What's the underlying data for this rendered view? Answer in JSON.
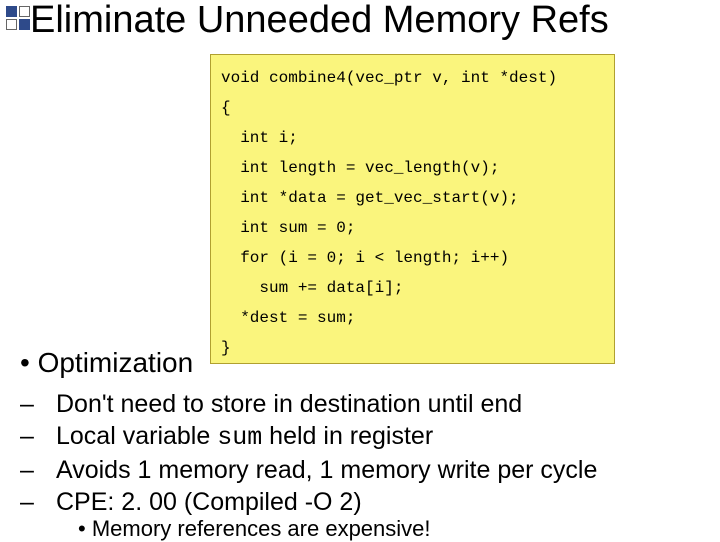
{
  "title": "Eliminate Unneeded Memory Refs",
  "code": {
    "l0": "void combine4(vec_ptr v, int *dest)",
    "l1": "{",
    "l2": "  int i;",
    "l3": "  int length = vec_length(v);",
    "l4": "  int *data = get_vec_start(v);",
    "l5": "  int sum = 0;",
    "l6": "  for (i = 0; i < length; i++)",
    "l7": "    sum += data[i];",
    "l8": "  *dest = sum;",
    "l9": "}"
  },
  "heading": "• Optimization",
  "bullets": {
    "b1": "Don't need to store in destination until end",
    "b2_pre": "Local variable ",
    "b2_code": "sum",
    "b2_post": " held in register",
    "b3": "Avoids 1 memory read, 1 memory write per cycle",
    "b4": "CPE:   2. 00 (Compiled -O 2)"
  },
  "subbullet": "• Memory references are expensive!",
  "dash": "–"
}
